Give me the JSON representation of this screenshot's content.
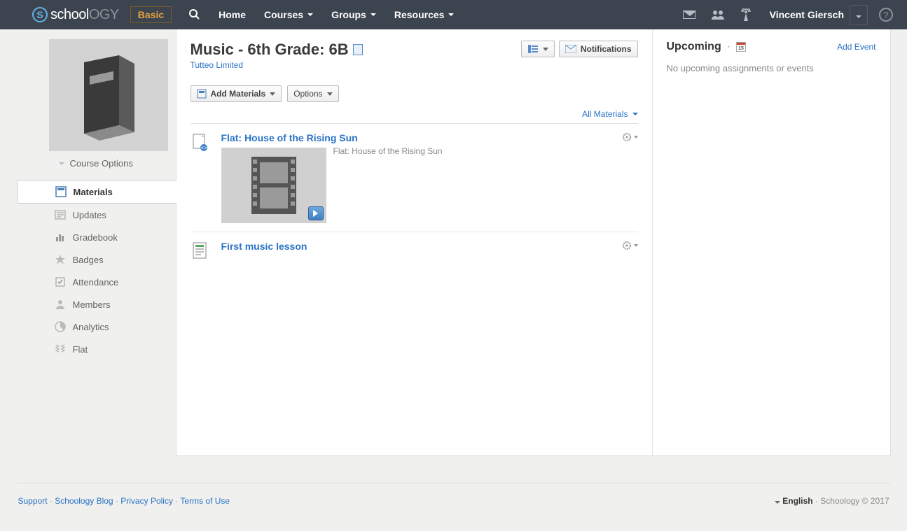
{
  "brand": {
    "letter": "S",
    "text_school": "school",
    "text_ogy": "OGY",
    "badge": "Basic"
  },
  "nav": {
    "home": "Home",
    "courses": "Courses",
    "groups": "Groups",
    "resources": "Resources",
    "user": "Vincent Giersch"
  },
  "sidebar": {
    "course_options": "Course Options",
    "items": [
      {
        "label": "Materials"
      },
      {
        "label": "Updates"
      },
      {
        "label": "Gradebook"
      },
      {
        "label": "Badges"
      },
      {
        "label": "Attendance"
      },
      {
        "label": "Members"
      },
      {
        "label": "Analytics"
      },
      {
        "label": "Flat"
      }
    ]
  },
  "course": {
    "title": "Music - 6th Grade: 6B",
    "org": "Tutteo Limited"
  },
  "header_buttons": {
    "notifications": "Notifications"
  },
  "toolbar": {
    "add_materials": "Add Materials",
    "options": "Options",
    "filter": "All Materials"
  },
  "materials": [
    {
      "title": "Flat: House of the Rising Sun",
      "subtitle": "Flat: House of the Rising Sun",
      "has_thumb": true
    },
    {
      "title": "First music lesson",
      "has_thumb": false
    }
  ],
  "upcoming": {
    "title": "Upcoming",
    "cal_day": "15",
    "add_event": "Add Event",
    "empty": "No upcoming assignments or events"
  },
  "footer": {
    "support": "Support",
    "blog": "Schoology Blog",
    "privacy": "Privacy Policy",
    "terms": "Terms of Use",
    "language": "English",
    "copyright": "Schoology © 2017"
  }
}
